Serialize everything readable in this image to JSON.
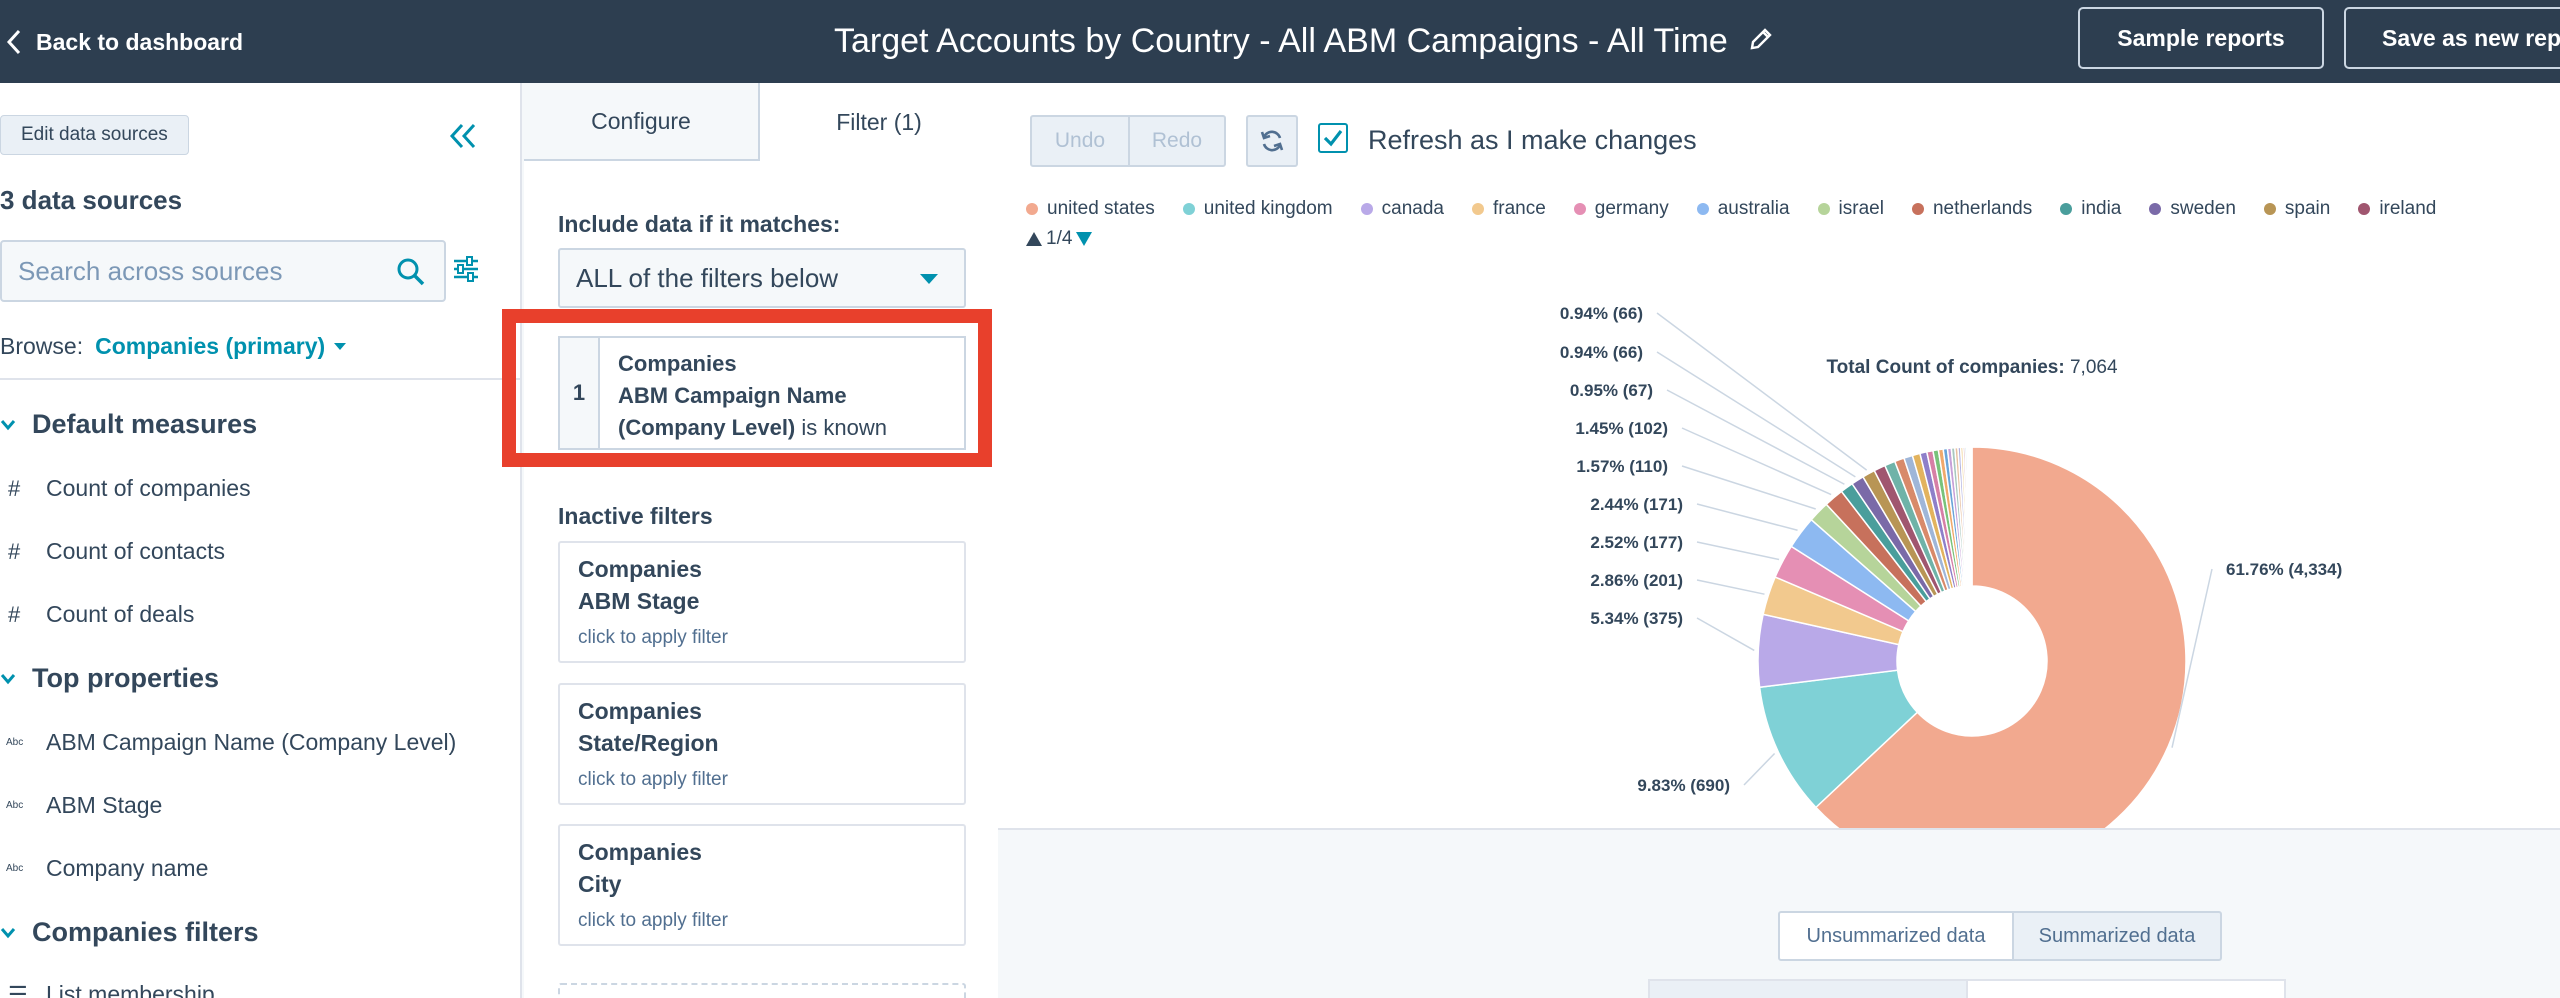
{
  "header": {
    "back_label": "Back to dashboard",
    "title": "Target Accounts by Country - All ABM Campaigns - All Time",
    "sample_reports": "Sample reports",
    "save_as_new": "Save as new rep"
  },
  "sidebar": {
    "edit_data_sources": "Edit data sources",
    "data_sources_count": "3 data sources",
    "search_placeholder": "Search across sources",
    "browse_label": "Browse:",
    "browse_value": "Companies (primary)",
    "groups": [
      {
        "label": "Default measures"
      },
      {
        "label": "Top properties"
      },
      {
        "label": "Companies filters"
      }
    ],
    "measures": [
      "Count of companies",
      "Count of contacts",
      "Count of deals"
    ],
    "properties": [
      "ABM Campaign Name (Company Level)",
      "ABM Stage",
      "Company name"
    ],
    "filters": [
      "List membership"
    ],
    "abc_tag": "Abc",
    "hash_tag": "#"
  },
  "filter_panel": {
    "tabs": {
      "configure": "Configure",
      "filter": "Filter (1)"
    },
    "include_label": "Include data if it matches:",
    "match_value": "ALL of the filters below",
    "active_filter": {
      "number": "1",
      "object": "Companies",
      "property": "ABM Campaign Name (Company Level)",
      "property_line1": "ABM Campaign Name",
      "property_line2": "(Company Level)",
      "operator": "is known"
    },
    "inactive_label": "Inactive filters",
    "inactive_filters": [
      {
        "object": "Companies",
        "property": "ABM Stage",
        "hint": "click to apply filter"
      },
      {
        "object": "Companies",
        "property": "State/Region",
        "hint": "click to apply filter"
      },
      {
        "object": "Companies",
        "property": "City",
        "hint": "click to apply filter"
      }
    ]
  },
  "toolbar": {
    "undo": "Undo",
    "redo": "Redo",
    "refresh_label": "Refresh as I make changes",
    "refresh_checked": true
  },
  "legend": {
    "items": [
      {
        "label": "united states",
        "color": "#f2a98f"
      },
      {
        "label": "united kingdom",
        "color": "#7fd1d6"
      },
      {
        "label": "canada",
        "color": "#b9a9e8"
      },
      {
        "label": "france",
        "color": "#f2c98e"
      },
      {
        "label": "germany",
        "color": "#e58fb4"
      },
      {
        "label": "australia",
        "color": "#8db9f1"
      },
      {
        "label": "israel",
        "color": "#b6d49a"
      },
      {
        "label": "netherlands",
        "color": "#c7715c"
      },
      {
        "label": "india",
        "color": "#4a9e9c"
      },
      {
        "label": "sweden",
        "color": "#7a6aa8"
      },
      {
        "label": "spain",
        "color": "#b89555"
      },
      {
        "label": "ireland",
        "color": "#a0566f"
      }
    ],
    "page": "1/4"
  },
  "chart_data": {
    "type": "pie",
    "donut": true,
    "title_label": "Total Count of companies:",
    "title_value": "7,064",
    "total": 7064,
    "slices": [
      {
        "name": "united states",
        "value": 4334,
        "label": "61.76% (4,334)",
        "color": "#f2a98f"
      },
      {
        "name": "united kingdom",
        "value": 690,
        "label": "9.83% (690)",
        "color": "#7fd1d6"
      },
      {
        "name": "canada",
        "value": 375,
        "label": "5.34% (375)",
        "color": "#b9a9e8"
      },
      {
        "name": "france",
        "value": 201,
        "label": "2.86% (201)",
        "color": "#f2c98e"
      },
      {
        "name": "germany",
        "value": 177,
        "label": "2.52% (177)",
        "color": "#e58fb4"
      },
      {
        "name": "australia",
        "value": 171,
        "label": "2.44% (171)",
        "color": "#8db9f1"
      },
      {
        "name": "israel",
        "value": 110,
        "label": "1.57% (110)",
        "color": "#b6d49a"
      },
      {
        "name": "netherlands",
        "value": 102,
        "label": "1.45% (102)",
        "color": "#c7715c"
      },
      {
        "name": "india",
        "value": 67,
        "label": "0.95% (67)",
        "color": "#4a9e9c"
      },
      {
        "name": "sweden",
        "value": 66,
        "label": "0.94% (66)",
        "color": "#7a6aa8"
      },
      {
        "name": "spain",
        "value": 66,
        "label": "0.94% (66)",
        "color": "#b89555"
      },
      {
        "name": "ireland",
        "value": 60,
        "label": "",
        "color": "#a0566f"
      },
      {
        "name": "",
        "value": 55,
        "label": "",
        "color": "#6fb3a8"
      },
      {
        "name": "",
        "value": 50,
        "label": "",
        "color": "#d88a6a"
      },
      {
        "name": "",
        "value": 45,
        "label": "",
        "color": "#9fb6d8"
      },
      {
        "name": "",
        "value": 40,
        "label": "",
        "color": "#e2b35e"
      },
      {
        "name": "",
        "value": 36,
        "label": "",
        "color": "#8e7fc9"
      },
      {
        "name": "",
        "value": 32,
        "label": "",
        "color": "#d67fa6"
      },
      {
        "name": "",
        "value": 28,
        "label": "",
        "color": "#79c27a"
      },
      {
        "name": "",
        "value": 25,
        "label": "",
        "color": "#f0a96b"
      },
      {
        "name": "",
        "value": 22,
        "label": "",
        "color": "#6aa5d8"
      },
      {
        "name": "",
        "value": 20,
        "label": "",
        "color": "#c7a0d8"
      },
      {
        "name": "",
        "value": 18,
        "label": "",
        "color": "#a8c8c0"
      },
      {
        "name": "",
        "value": 16,
        "label": "",
        "color": "#e8c0a0"
      },
      {
        "name": "",
        "value": 14,
        "label": "",
        "color": "#b0b0e0"
      },
      {
        "name": "",
        "value": 12,
        "label": "",
        "color": "#f0d090"
      },
      {
        "name": "",
        "value": 10,
        "label": "",
        "color": "#d0a0b0"
      },
      {
        "name": "",
        "value": 9,
        "label": "",
        "color": "#a0d0e8"
      },
      {
        "name": "",
        "value": 8,
        "label": "",
        "color": "#c0d8a0"
      },
      {
        "name": "",
        "value": 7,
        "label": "",
        "color": "#e0b0c8"
      },
      {
        "name": "",
        "value": 6,
        "label": "",
        "color": "#c8c8c8"
      },
      {
        "name": "",
        "value": 6,
        "label": "",
        "color": "#dddddd"
      }
    ]
  },
  "bottom": {
    "unsummarized": "Unsummarized data",
    "summarized": "Summarized data"
  }
}
